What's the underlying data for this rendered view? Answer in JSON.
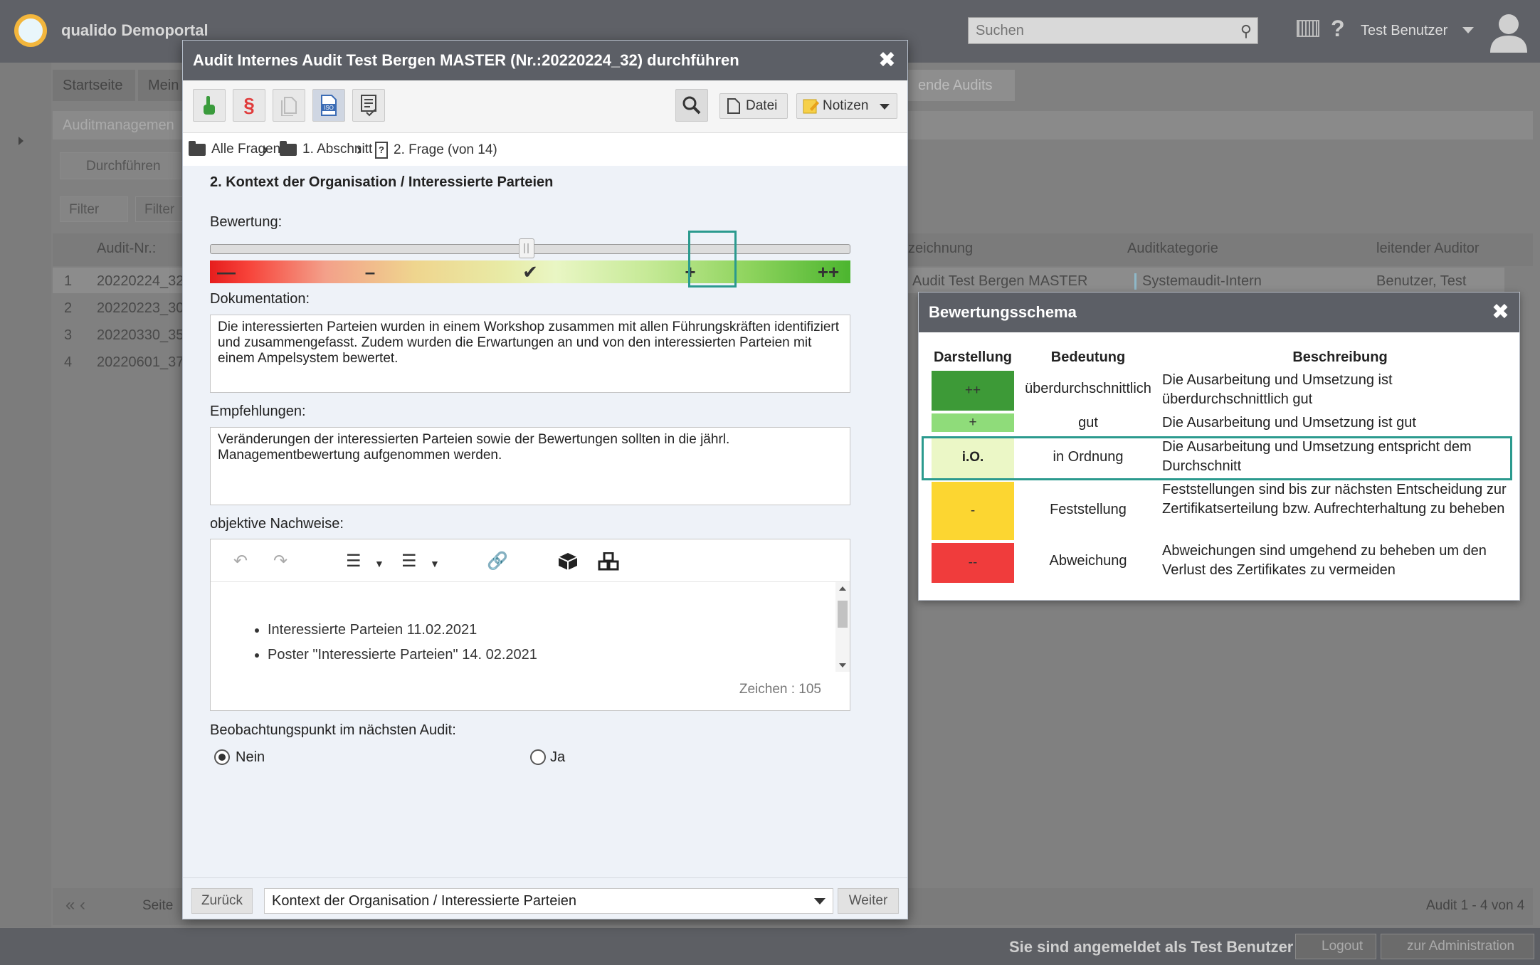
{
  "app": {
    "title": "qualido Demoportal",
    "search_placeholder": "Suchen",
    "user_name": "Test Benutzer"
  },
  "background": {
    "tabs": [
      "Startseite",
      "Mein",
      "ende Audits"
    ],
    "panel_title": "Auditmanagemen",
    "run_button": "Durchführen",
    "filter_label": "Filter",
    "filter_input": "Filter",
    "columns": [
      "Audit-Nr.:",
      "zeichnung",
      "Auditkategorie",
      "leitender Auditor"
    ],
    "rows": [
      {
        "n": "1",
        "nr": "20220224_32",
        "name": "Audit Test Bergen MASTER",
        "category": "Systemaudit-Intern",
        "auditor": "Benutzer, Test"
      },
      {
        "n": "2",
        "nr": "20220223_30",
        "name": "",
        "category": "",
        "auditor": ""
      },
      {
        "n": "3",
        "nr": "20220330_35",
        "name": "",
        "category": "",
        "auditor": ""
      },
      {
        "n": "4",
        "nr": "20220601_37",
        "name": "",
        "category": "",
        "auditor": ""
      }
    ],
    "footer_page": "Seite",
    "footer_count": "Audit 1 - 4 von 4"
  },
  "status_bar": {
    "text": "Sie sind angemeldet als Test Benutzer",
    "logout": "Logout",
    "admin": "zur Administration"
  },
  "modal": {
    "title": "Audit Internes Audit Test Bergen MASTER (Nr.:20220224_32) durchführen",
    "file_button": "Datei",
    "notes_button": "Notizen",
    "breadcrumb": {
      "all": "Alle Fragen",
      "section": "1. Abschnitt",
      "question": "2. Frage (von 14)"
    },
    "question_title": "2. Kontext der Organisation / Interessierte Parteien",
    "rating_label": "Bewertung:",
    "rating_scale_marks": [
      "—",
      "–",
      "✔",
      "+",
      "++"
    ],
    "rating_level": 0.5,
    "doc_label": "Dokumentation:",
    "doc_text": "Die interessierten Parteien wurden in einem Workshop zusammen mit allen Führungskräften identifiziert und zusammengefasst. Zudem wurden die Erwartungen an und von den interessierten Parteien mit einem Ampelsystem bewertet.",
    "rec_label": "Empfehlungen:",
    "rec_text": "Veränderungen der interessierten Parteien sowie der Bewertungen sollten in die jährl. Managementbewertung aufgenommen werden.",
    "evidence_label": "objektive Nachweise:",
    "evidence_items": [
      "Interessierte Parteien 11.02.2021",
      "Poster \"Interessierte Parteien\" 14. 02.2021"
    ],
    "char_count": "Zeichen : 105",
    "observe_label": "Beobachtungspunkt im nächsten Audit:",
    "observe_no": "Nein",
    "observe_yes": "Ja",
    "back_button": "Zurück",
    "next_button": "Weiter",
    "question_select": "Kontext der Organisation / Interessierte Parteien"
  },
  "scheme": {
    "title": "Bewertungsschema",
    "headers": [
      "Darstellung",
      "Bedeutung",
      "Beschreibung"
    ],
    "rows": [
      {
        "sym": "++",
        "meaning": "überdurchschnittlich",
        "desc": "Die Ausarbeitung und Umsetzung ist überdurchschnittlich gut",
        "color": "#3d9a37"
      },
      {
        "sym": "+",
        "meaning": "gut",
        "desc": "Die Ausarbeitung und Umsetzung ist gut",
        "color": "#8fdc7a"
      },
      {
        "sym": "i.O.",
        "meaning": "in Ordnung",
        "desc": "Die Ausarbeitung und Umsetzung entspricht dem Durchschnitt",
        "color": "#ebf7c6"
      },
      {
        "sym": "-",
        "meaning": "Feststellung",
        "desc": "Feststellungen sind bis zur nächsten Entscheidung zur Zertifikatserteilung bzw. Aufrechterhaltung zu beheben",
        "color": "#fcd631"
      },
      {
        "sym": "--",
        "meaning": "Abweichung",
        "desc": "Abweichungen sind umgehend zu beheben um den Verlust des Zertifikates zu vermeiden",
        "color": "#f03c3c"
      }
    ]
  }
}
